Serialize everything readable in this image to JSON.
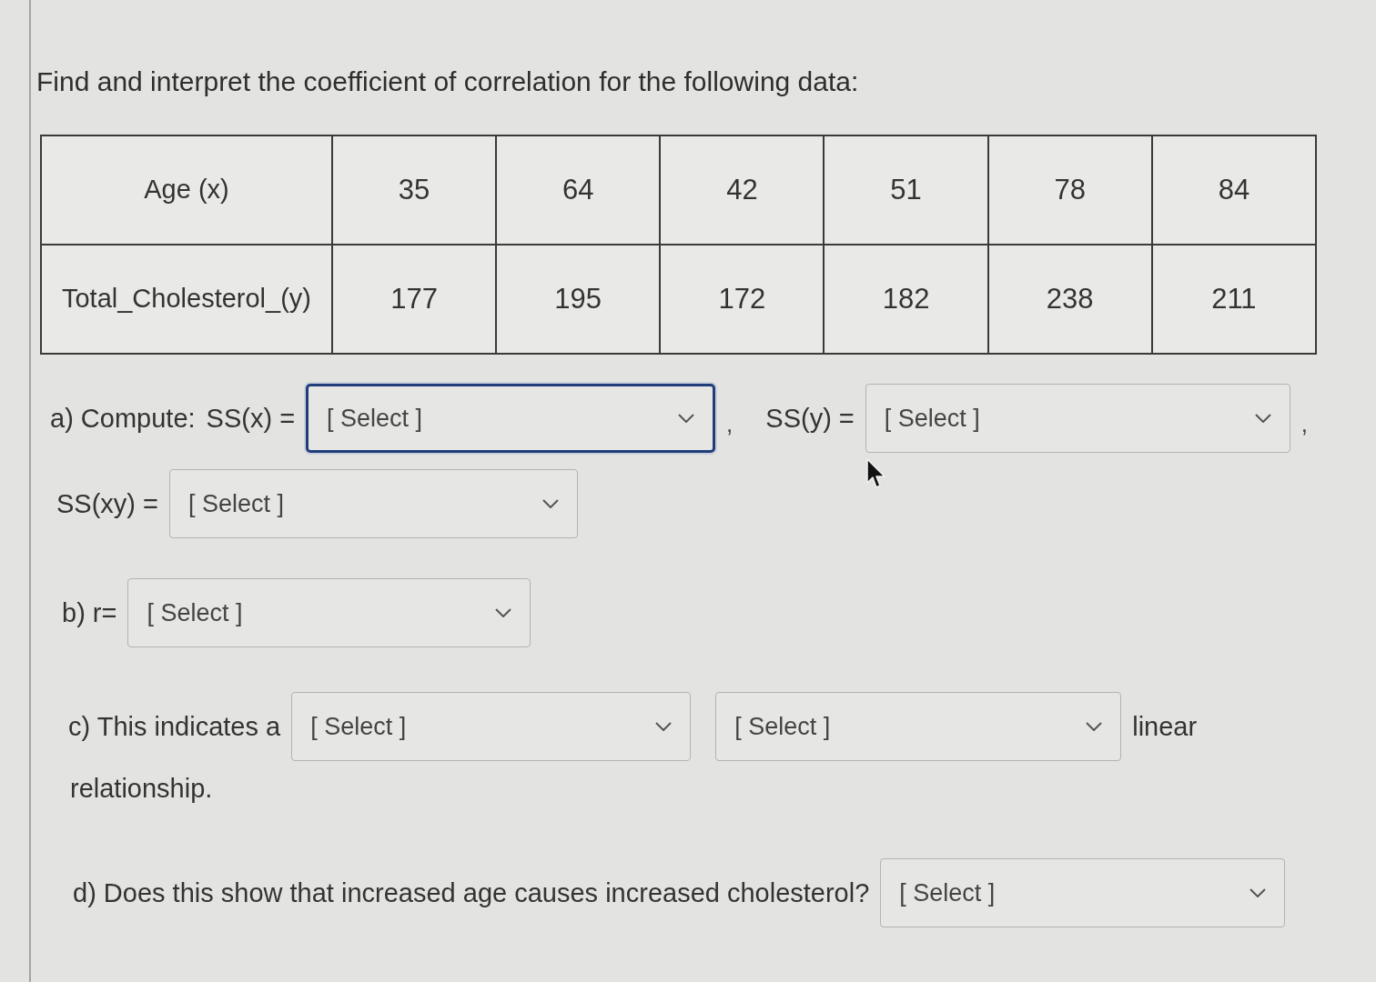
{
  "prompt": "Find and interpret the coefficient of correlation for the following data:",
  "table": {
    "rows": [
      {
        "header": "Age (x)",
        "cells": [
          "35",
          "64",
          "42",
          "51",
          "78",
          "84"
        ]
      },
      {
        "header": "Total_Cholesterol_(y)",
        "cells": [
          "177",
          "195",
          "172",
          "182",
          "238",
          "211"
        ]
      }
    ]
  },
  "lines": [
    {
      "items": [
        {
          "kind": "text",
          "text": "a) Compute:"
        },
        {
          "kind": "text",
          "text": "SS(x) ="
        },
        {
          "kind": "select",
          "value": "[ Select ]",
          "focused": true
        },
        {
          "kind": "punct",
          "text": ","
        },
        {
          "kind": "text",
          "text": "SS(y) ="
        },
        {
          "kind": "select",
          "value": "[ Select ]",
          "focused": false
        },
        {
          "kind": "punct",
          "text": ","
        }
      ]
    },
    {
      "items": [
        {
          "kind": "text",
          "text": "SS(xy) ="
        },
        {
          "kind": "select",
          "value": "[ Select ]",
          "focused": false
        }
      ]
    },
    {
      "items": [
        {
          "kind": "text",
          "text": "b) r="
        },
        {
          "kind": "select",
          "value": "[ Select ]",
          "focused": false
        }
      ]
    },
    {
      "items": [
        {
          "kind": "text",
          "text": "c) This indicates a"
        },
        {
          "kind": "select",
          "value": "[ Select ]",
          "focused": false
        },
        {
          "kind": "select",
          "value": "[ Select ]",
          "focused": false
        },
        {
          "kind": "text",
          "text": "linear"
        }
      ]
    },
    {
      "items": [
        {
          "kind": "text",
          "text": "relationship."
        }
      ]
    },
    {
      "items": [
        {
          "kind": "text",
          "text": "d) Does this show that increased age causes increased cholesterol?"
        },
        {
          "kind": "select",
          "value": "[ Select ]",
          "focused": false
        }
      ]
    }
  ]
}
